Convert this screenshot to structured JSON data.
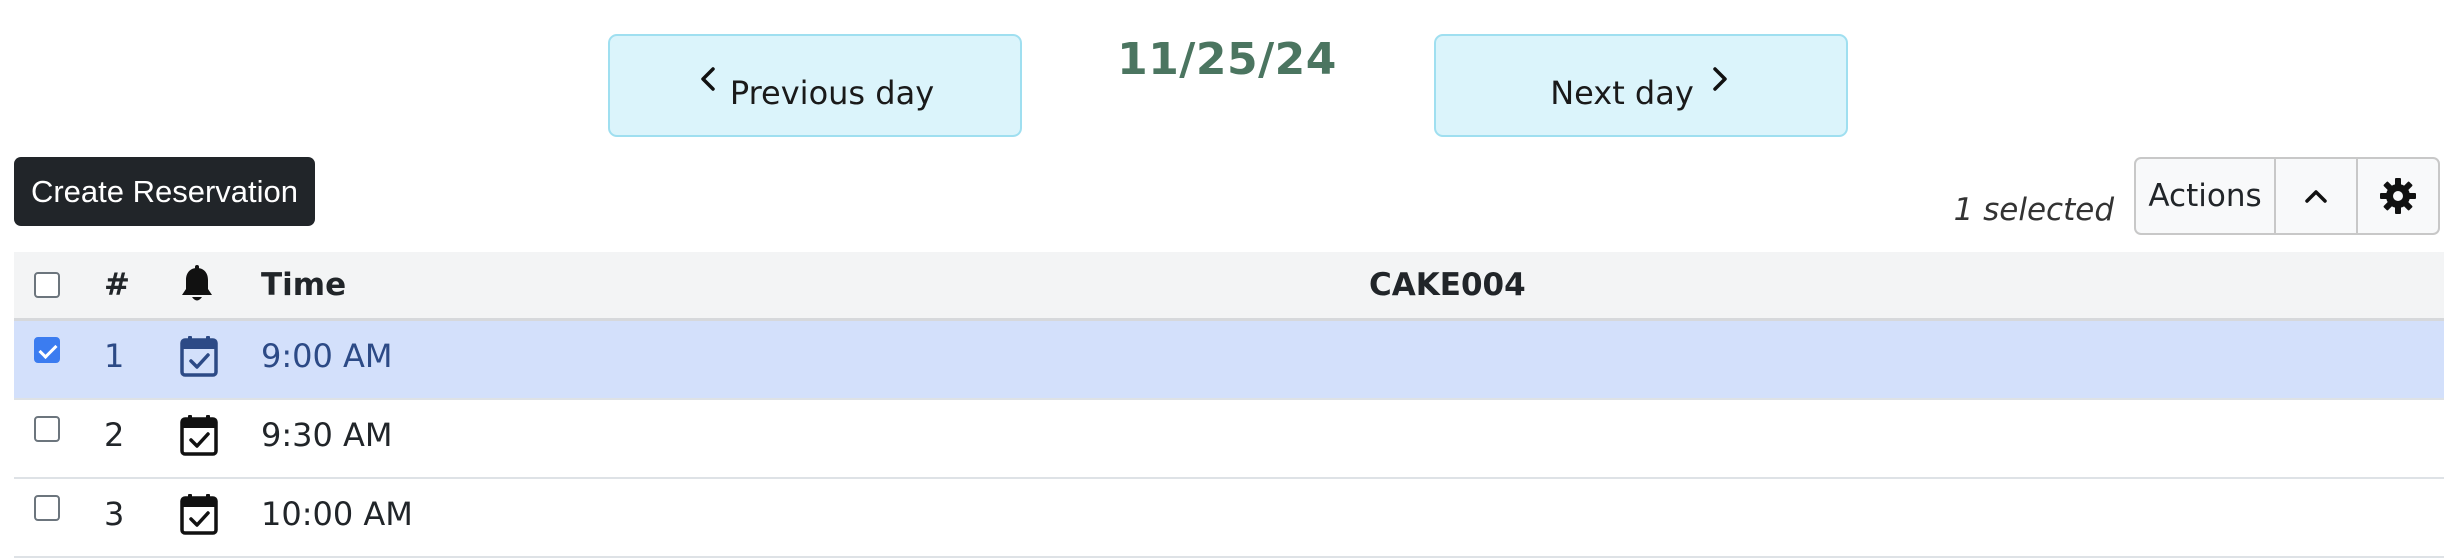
{
  "nav": {
    "prev_label": "Previous day",
    "next_label": "Next day",
    "current_date": "11/25/24"
  },
  "toolbar": {
    "create_label": "Create Reservation",
    "selected_count": "1 selected",
    "actions_label": "Actions",
    "collapse_icon": "chevron-up-icon",
    "settings_icon": "gear-icon"
  },
  "table": {
    "headers": {
      "number": "#",
      "notify_icon": "bell-icon",
      "time": "Time",
      "resource": "CAKE004"
    },
    "rows": [
      {
        "number": "1",
        "time": "9:00 AM",
        "checked": true,
        "icon": "calendar-check-icon"
      },
      {
        "number": "2",
        "time": "9:30 AM",
        "checked": false,
        "icon": "calendar-check-icon"
      },
      {
        "number": "3",
        "time": "10:00 AM",
        "checked": false,
        "icon": "calendar-check-icon"
      }
    ]
  },
  "colors": {
    "nav_button_bg": "#dbf4fb",
    "date_title": "#4b7560",
    "create_button_bg": "#212529",
    "selected_row_bg": "#d3e0fb",
    "checkbox_checked": "#3b7cf0"
  }
}
